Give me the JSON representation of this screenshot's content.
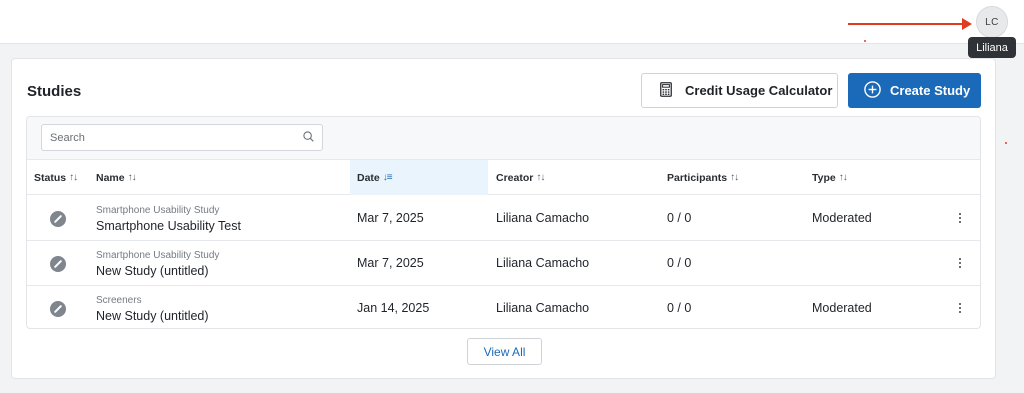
{
  "header": {
    "avatar_initials": "LC",
    "avatar_tooltip": "Liliana"
  },
  "studies": {
    "title": "Studies",
    "credit_button_label": "Credit Usage Calculator",
    "create_button_label": "Create Study",
    "search_placeholder": "Search",
    "columns": {
      "status": "Status",
      "name": "Name",
      "date": "Date",
      "creator": "Creator",
      "participants": "Participants",
      "type": "Type"
    },
    "rows": [
      {
        "project": "Smartphone Usability Study",
        "name": "Smartphone Usability Test",
        "date": "Mar 7, 2025",
        "creator": "Liliana Camacho",
        "participants": "0 / 0",
        "type": "Moderated"
      },
      {
        "project": "Smartphone Usability Study",
        "name": "New Study (untitled)",
        "date": "Mar 7, 2025",
        "creator": "Liliana Camacho",
        "participants": "0 / 0",
        "type": ""
      },
      {
        "project": "Screeners",
        "name": "New Study (untitled)",
        "date": "Jan 14, 2025",
        "creator": "Liliana Camacho",
        "participants": "0 / 0",
        "type": "Moderated"
      }
    ],
    "view_all_label": "View All"
  },
  "colors": {
    "accent": "#1b6ab9",
    "annotation_red": "#e03c1f",
    "status_icon": "#7f868e"
  },
  "icons": {
    "status": "draft-pencil-icon",
    "calculator": "calculator-icon",
    "create": "plus-circle-icon",
    "search": "search-icon",
    "row_menu": "more-vertical-icon"
  }
}
